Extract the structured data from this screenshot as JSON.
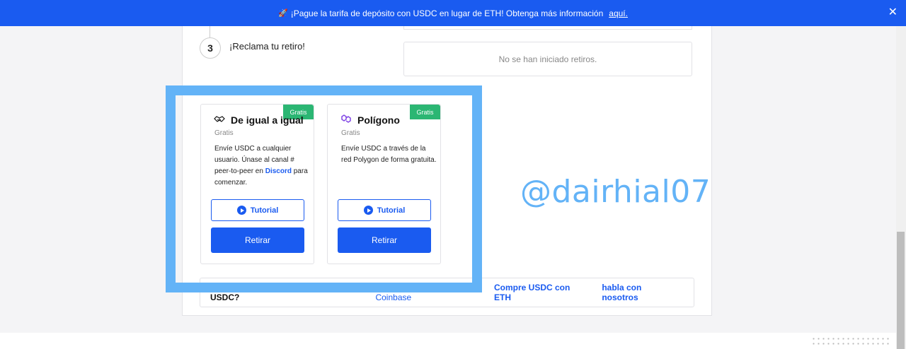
{
  "banner": {
    "message": "¡Pague la tarifa de depósito con USDC en lugar de ETH! Obtenga más información",
    "link": "aquí.",
    "icon": "rocket-icon",
    "close": "✕"
  },
  "step": {
    "number": "3",
    "label": "¡Reclama tu retiro!",
    "empty_state": "No se han iniciado retiros."
  },
  "options": [
    {
      "icon": "handshake-icon",
      "title": "De igual a igual",
      "tag": "Gratis",
      "fee": "Gratis",
      "desc_prefix": "Envíe USDC a cualquier usuario. Únase al canal # peer-to-peer en",
      "desc_link": "Discord",
      "desc_suffix": "para comenzar.",
      "tutorial": "Tutorial",
      "withdraw": "Retirar"
    },
    {
      "icon": "polygon-icon",
      "title": "Polígono",
      "tag": "Gratis",
      "fee": "Gratis",
      "desc": "Envíe USDC a través de la red Polygon de forma gratuita.",
      "tutorial": "Tutorial",
      "withdraw": "Retirar"
    }
  ],
  "help": {
    "question": "¿Necesita ayuda para comprar USDC?",
    "links": [
      "Compre USDC en Coinbase",
      "Compre USDC con ETH",
      "habla con nosotros"
    ]
  },
  "watermark": "@dairhial07",
  "colors": {
    "accent": "#1a5bf0",
    "free_tag": "#2bb673",
    "highlight": "#63b3f7"
  }
}
